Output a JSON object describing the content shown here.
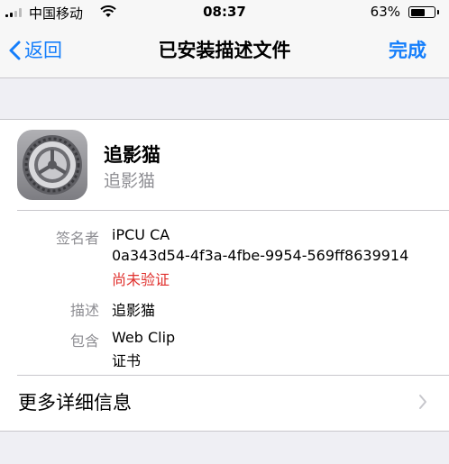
{
  "status_bar": {
    "carrier": "中国移动",
    "time": "08:37",
    "battery_percent": "63%",
    "battery_level": 0.63
  },
  "nav": {
    "back_label": "返回",
    "title": "已安装描述文件",
    "done_label": "完成"
  },
  "profile": {
    "name": "追影猫",
    "subtitle": "追影猫",
    "icon": "settings-gear-icon"
  },
  "details": {
    "signer_label": "签名者",
    "signer_name": "iPCU CA",
    "signer_id": "0a343d54-4f3a-4fbe-9954-569ff8639914",
    "verify_status": "尚未验证",
    "description_label": "描述",
    "description_value": "追影猫",
    "contains_label": "包含",
    "contains_items": [
      "Web Clip",
      "证书"
    ]
  },
  "more_info_label": "更多详细信息",
  "colors": {
    "accent": "#147efb",
    "warning": "#e0302d",
    "secondary_text": "#8e8e93",
    "background": "#efeff4"
  }
}
